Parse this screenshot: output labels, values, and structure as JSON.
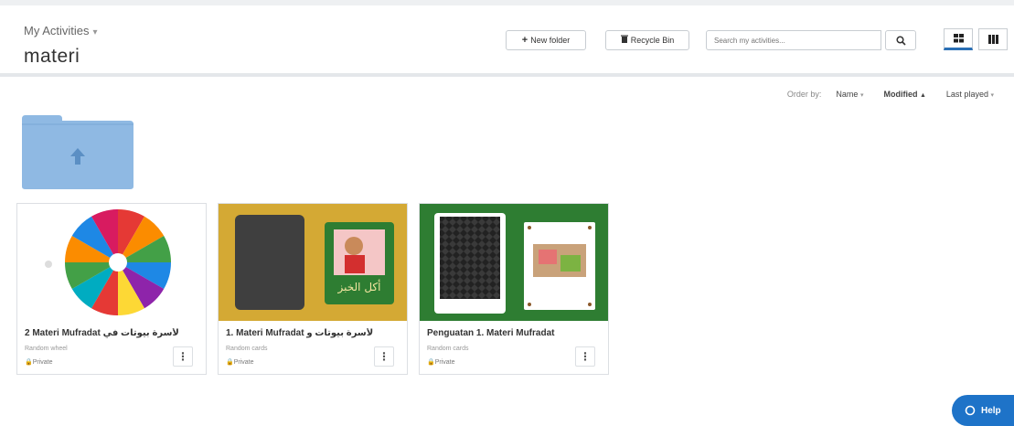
{
  "header": {
    "breadcrumb": "My Activities",
    "breadcrumb_caret": "▾",
    "title": "materi",
    "new_folder_label": "New folder",
    "recycle_bin_label": "Recycle Bin",
    "search_placeholder": "Search my activities..."
  },
  "order_bar": {
    "label": "Order by:",
    "items": [
      {
        "label": "Name",
        "arrow": "▾",
        "active": false
      },
      {
        "label": "Modified",
        "arrow": "▲",
        "active": true
      },
      {
        "label": "Last played",
        "arrow": "▾",
        "active": false
      }
    ]
  },
  "colors": {
    "accent": "#2a6fb5",
    "folder": "#8fb9e3",
    "help_button": "#1e73c8",
    "card2_bg": "#d4a934",
    "card3_bg": "#2e7d32"
  },
  "activities": [
    {
      "title": "2 Materi Mufradat ﻷﺳﺮﺓ ﺑﻴﻮﺗﺎﺕ ﻓﻲ",
      "type": "Random wheel",
      "privacy": "Private",
      "menu": "⋮"
    },
    {
      "title": "1. Materi Mufradat ﻷﺳﺮﺓ ﺑﻴﻮﺗﺎﺕ ﻭ",
      "type": "Random cards",
      "privacy": "Private",
      "menu": "⋮",
      "thumb_caption": "ﺃﻛﻞ ﺍﻟﺨﺒﺰ"
    },
    {
      "title": "Penguatan 1. Materi Mufradat",
      "type": "Random cards",
      "privacy": "Private",
      "menu": "⋮"
    }
  ],
  "help": {
    "label": "Help"
  }
}
